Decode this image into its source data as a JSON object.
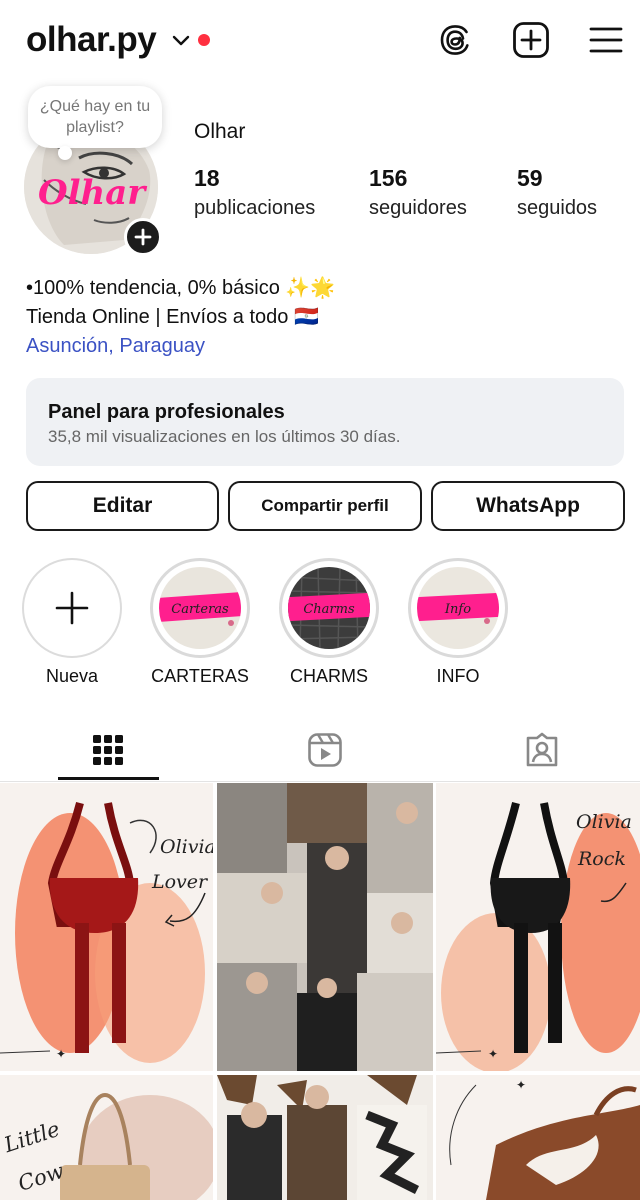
{
  "header": {
    "username": "olhar.py",
    "icons": [
      "chevron-down-icon",
      "threads-icon",
      "create-post-icon",
      "menu-icon"
    ],
    "notification_color": "#ff3040"
  },
  "profile": {
    "note": "¿Qué hay en tu playlist?",
    "display_name": "Olhar",
    "avatar_logo_text": "Olhar",
    "stats": [
      {
        "value": "18",
        "label": "publicaciones"
      },
      {
        "value": "156",
        "label": "seguidores"
      },
      {
        "value": "59",
        "label": "seguidos"
      }
    ],
    "bio_line1": "•100% tendencia, 0% básico ✨🌟",
    "bio_line2": "Tienda Online | Envíos a todo 🇵🇾",
    "location": "Asunción, Paraguay",
    "link_color": "#3b52c4"
  },
  "pro_panel": {
    "title": "Panel para profesionales",
    "subtitle": "35,8 mil visualizaciones en los últimos 30 días."
  },
  "buttons": {
    "edit": "Editar",
    "share": "Compartir perfil",
    "whatsapp": "WhatsApp"
  },
  "highlights": [
    {
      "label": "Nueva",
      "cover_text": ""
    },
    {
      "label": "CARTERAS",
      "cover_text": "Carteras"
    },
    {
      "label": "CHARMS",
      "cover_text": "Charms"
    },
    {
      "label": "INFO",
      "cover_text": "Info"
    }
  ],
  "tabs": [
    {
      "name": "posts",
      "icon": "grid-icon",
      "active": true
    },
    {
      "name": "reels",
      "icon": "reels-icon",
      "active": false
    },
    {
      "name": "tagged",
      "icon": "tagged-icon",
      "active": false
    }
  ],
  "posts": [
    {
      "caption_lines": [
        "Olivia",
        "Lover"
      ],
      "bag_color": "#9e1b1b"
    },
    {
      "caption_lines": [],
      "bag_color": ""
    },
    {
      "caption_lines": [
        "Olivia",
        "Rock"
      ],
      "bag_color": "#161616"
    },
    {
      "caption_lines": [
        "Little",
        "Cow"
      ],
      "bag_color": "#c9a57a"
    },
    {
      "caption_lines": [],
      "bag_color": ""
    },
    {
      "caption_lines": [],
      "bag_color": "#8a4a2a"
    }
  ],
  "accent_pink": "#ff1f8e"
}
